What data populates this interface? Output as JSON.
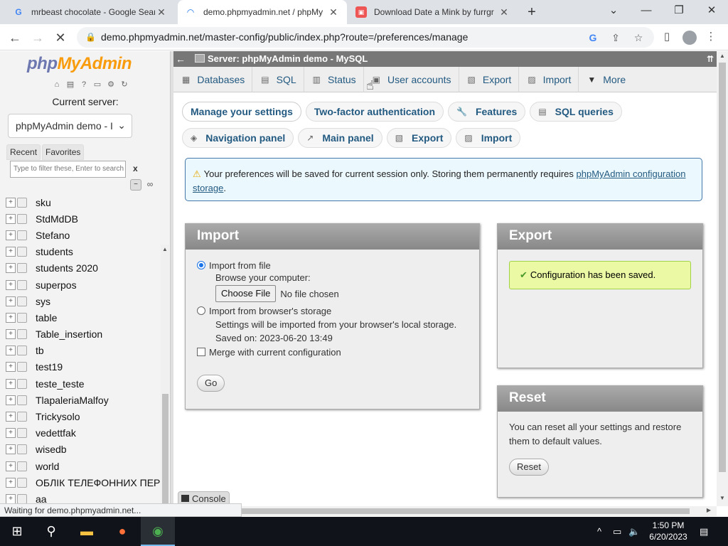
{
  "browser": {
    "tabs": [
      {
        "title": "mrbeast chocolate - Google Sear",
        "icon": "G"
      },
      {
        "title": "demo.phpmyadmin.net / phpMy",
        "icon": "loading"
      },
      {
        "title": "Download Date a Mink by furrgr",
        "icon": "image"
      }
    ],
    "url": "demo.phpmyadmin.net/master-config/public/index.php?route=/preferences/manage",
    "status_text": "Waiting for demo.phpmyadmin.net..."
  },
  "left_panel": {
    "logo_php": "php",
    "logo_myadmin": "MyAdmin",
    "current_server_label": "Current server:",
    "server_value": "phpMyAdmin demo - I",
    "tabs": [
      "Recent",
      "Favorites"
    ],
    "filter_placeholder": "Type to filter these, Enter to search al",
    "filter_clear": "x",
    "databases": [
      "sku",
      "StdMdDB",
      "Stefano",
      "students",
      "students 2020",
      "superpos",
      "sys",
      "table",
      "Table_insertion",
      "tb",
      "test19",
      "teste_teste",
      "TlapaleriaMalfoy",
      "Trickysolo",
      "vedettfak",
      "wisedb",
      "world",
      "ОБЛІК ТЕЛЕФОННИХ ПЕРЕГ",
      "aa"
    ]
  },
  "main": {
    "server_title": "Server: phpMyAdmin demo - MySQL",
    "top_menu": [
      "Databases",
      "SQL",
      "Status",
      "User accounts",
      "Export",
      "Import",
      "More"
    ],
    "sub_nav_row1": [
      "Manage your settings",
      "Two-factor authentication",
      "Features",
      "SQL queries"
    ],
    "sub_nav_row2": [
      "Navigation panel",
      "Main panel",
      "Export",
      "Import"
    ],
    "notice_text": "Your preferences will be saved for current session only. Storing them permanently requires ",
    "notice_link": "phpMyAdmin configuration storage",
    "notice_end": ".",
    "import": {
      "title": "Import",
      "from_file": "Import from file",
      "browse": "Browse your computer:",
      "choose_file": "Choose File",
      "no_file": "No file chosen",
      "from_storage": "Import from browser's storage",
      "storage_desc": "Settings will be imported from your browser's local storage.",
      "saved_on": "Saved on: 2023-06-20 13:49",
      "merge": "Merge with current configuration",
      "go": "Go"
    },
    "export": {
      "title": "Export",
      "success": "Configuration has been saved."
    },
    "reset": {
      "title": "Reset",
      "desc": "You can reset all your settings and restore them to default values.",
      "button": "Reset"
    },
    "console": "Console"
  },
  "taskbar": {
    "time": "1:50 PM",
    "date": "6/20/2023"
  }
}
